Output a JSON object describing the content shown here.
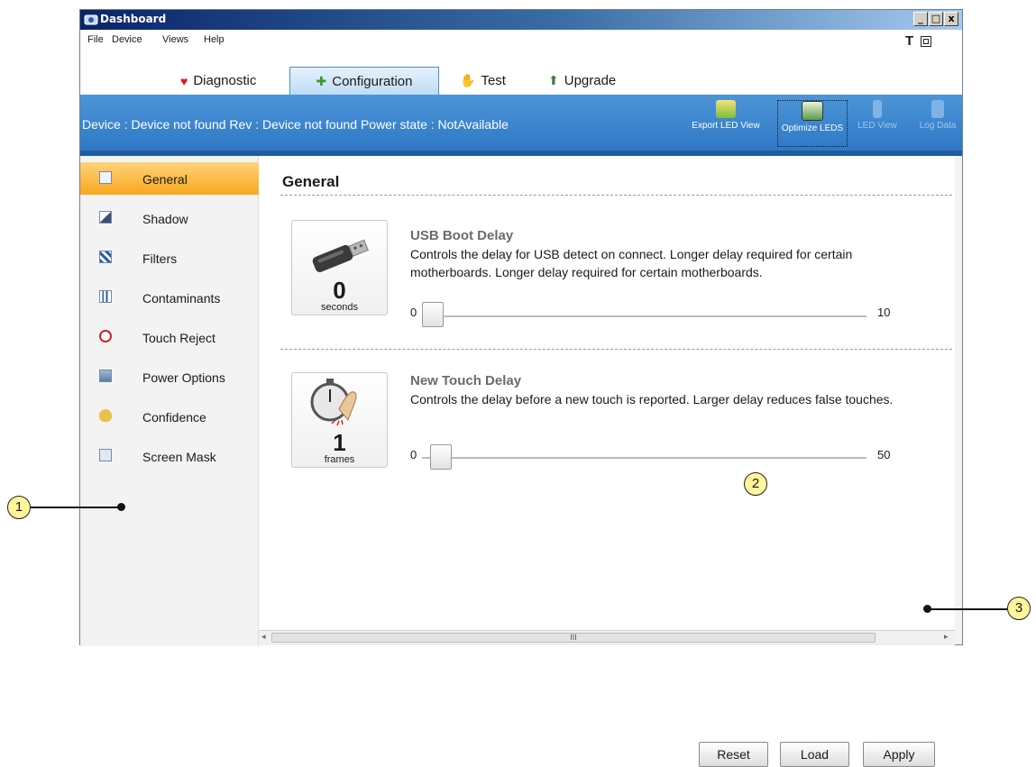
{
  "window": {
    "title": "Dashboard",
    "controls": [
      "_",
      "□",
      "x"
    ]
  },
  "menu": {
    "items": [
      "File",
      "Device",
      "Views",
      "Help"
    ],
    "right_glyph": "T"
  },
  "tabs": [
    {
      "label": "Diagnostic",
      "icon": "heart-icon",
      "active": false
    },
    {
      "label": "Configuration",
      "icon": "puzzle-icon",
      "active": true
    },
    {
      "label": "Test",
      "icon": "hand-icon",
      "active": false
    },
    {
      "label": "Upgrade",
      "icon": "upgrade-icon",
      "active": false
    }
  ],
  "device_bar": {
    "status_text": "Device : Device not found Rev : Device not found Power state : NotAvailable",
    "tools": [
      {
        "label": "Export LED View",
        "icon": "export-icon",
        "enabled": true
      },
      {
        "label": "Optimize LEDS",
        "icon": "optimize-icon",
        "enabled": true
      },
      {
        "label": "LED View",
        "icon": "led-view-icon",
        "enabled": false
      },
      {
        "label": "Log Data",
        "icon": "log-data-icon",
        "enabled": false
      }
    ]
  },
  "sidebar": {
    "items": [
      {
        "label": "General",
        "icon": "general-icon",
        "active": true
      },
      {
        "label": "Shadow",
        "icon": "shadow-icon",
        "active": false
      },
      {
        "label": "Filters",
        "icon": "filters-icon",
        "active": false
      },
      {
        "label": "Contaminants",
        "icon": "contaminants-icon",
        "active": false
      },
      {
        "label": "Touch Reject",
        "icon": "touch-reject-icon",
        "active": false
      },
      {
        "label": "Power Options",
        "icon": "power-options-icon",
        "active": false
      },
      {
        "label": "Confidence",
        "icon": "confidence-icon",
        "active": false
      },
      {
        "label": "Screen Mask",
        "icon": "screen-mask-icon",
        "active": false
      }
    ]
  },
  "content": {
    "heading": "General",
    "settings": [
      {
        "title": "USB Boot Delay",
        "description": "Controls the delay for USB detect on connect.  Longer delay required for certain motherboards. Longer delay required for certain motherboards.",
        "value": "0",
        "unit": "seconds",
        "icon": "usb-icon",
        "min": "0",
        "max": "10",
        "slider_value": 0
      },
      {
        "title": "New Touch Delay",
        "description": "Controls the delay before a new touch is reported.  Larger delay reduces false touches.",
        "value": "1",
        "unit": "frames",
        "icon": "stopwatch-touch-icon",
        "min": "0",
        "max": "50",
        "slider_value": 1
      }
    ]
  },
  "buttons": {
    "reset": "Reset",
    "load": "Load",
    "apply": "Apply"
  },
  "scrollbar": {
    "grip": "III"
  },
  "callouts": [
    "1",
    "2",
    "3"
  ]
}
